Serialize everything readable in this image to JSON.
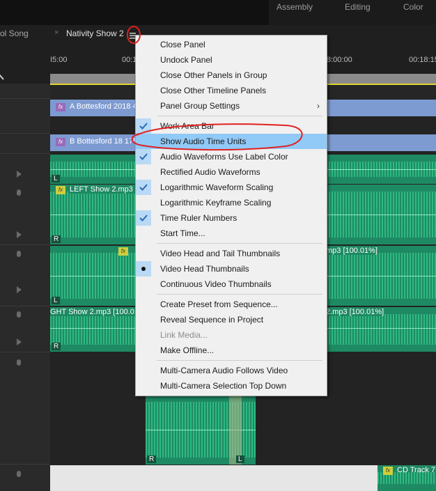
{
  "workspace_tabs": [
    "Assembly",
    "Editing",
    "Color"
  ],
  "panel_tabs": {
    "left": "ol Song",
    "active": "Nativity Show 2"
  },
  "ruler": {
    "ticks": [
      "I5:00",
      "00:1",
      "8:00:00",
      "00:18:15"
    ]
  },
  "clips": {
    "video_a": "A Bottesford 2018 4",
    "video_b": "B Bottesford 18 175",
    "audio_left": "LEFT Show 2.mp3 [",
    "audio_mp3_a": "mp3 [100.01%]",
    "audio_right": "GHT Show 2.mp3 [100.01%",
    "audio_mp3_b": "2.mp3 [100.01%]",
    "audio_cd": "CD Track 7",
    "channel_labels": [
      "L",
      "R",
      "L",
      "R",
      "R",
      "L"
    ],
    "fx_label": "fx"
  },
  "menu": {
    "items": [
      {
        "label": "Close Panel"
      },
      {
        "label": "Undock Panel"
      },
      {
        "label": "Close Other Panels in Group"
      },
      {
        "label": "Close Other Timeline Panels"
      },
      {
        "label": "Panel Group Settings"
      },
      {
        "label": "Work Area Bar"
      },
      {
        "label": "Show Audio Time Units"
      },
      {
        "label": "Audio Waveforms Use Label Color"
      },
      {
        "label": "Rectified Audio Waveforms"
      },
      {
        "label": "Logarithmic Waveform Scaling"
      },
      {
        "label": "Logarithmic Keyframe Scaling"
      },
      {
        "label": "Time Ruler Numbers"
      },
      {
        "label": "Start Time..."
      },
      {
        "label": "Video Head and Tail Thumbnails"
      },
      {
        "label": "Video Head Thumbnails"
      },
      {
        "label": "Continuous Video Thumbnails"
      },
      {
        "label": "Create Preset from Sequence..."
      },
      {
        "label": "Reveal Sequence in Project"
      },
      {
        "label": "Link Media..."
      },
      {
        "label": "Make Offline..."
      },
      {
        "label": "Multi-Camera Audio Follows Video"
      },
      {
        "label": "Multi-Camera Selection Top Down"
      }
    ],
    "checked": [
      "Work Area Bar",
      "Audio Waveforms Use Label Color",
      "Logarithmic Waveform Scaling",
      "Time Ruler Numbers"
    ],
    "selected_radio": "Video Head Thumbnails",
    "highlighted": "Show Audio Time Units",
    "submenu_arrow": "›",
    "colors": {
      "highlight": "#91c9f7",
      "check_bg": "#b9d9f5",
      "annotation": "#e02020"
    }
  }
}
